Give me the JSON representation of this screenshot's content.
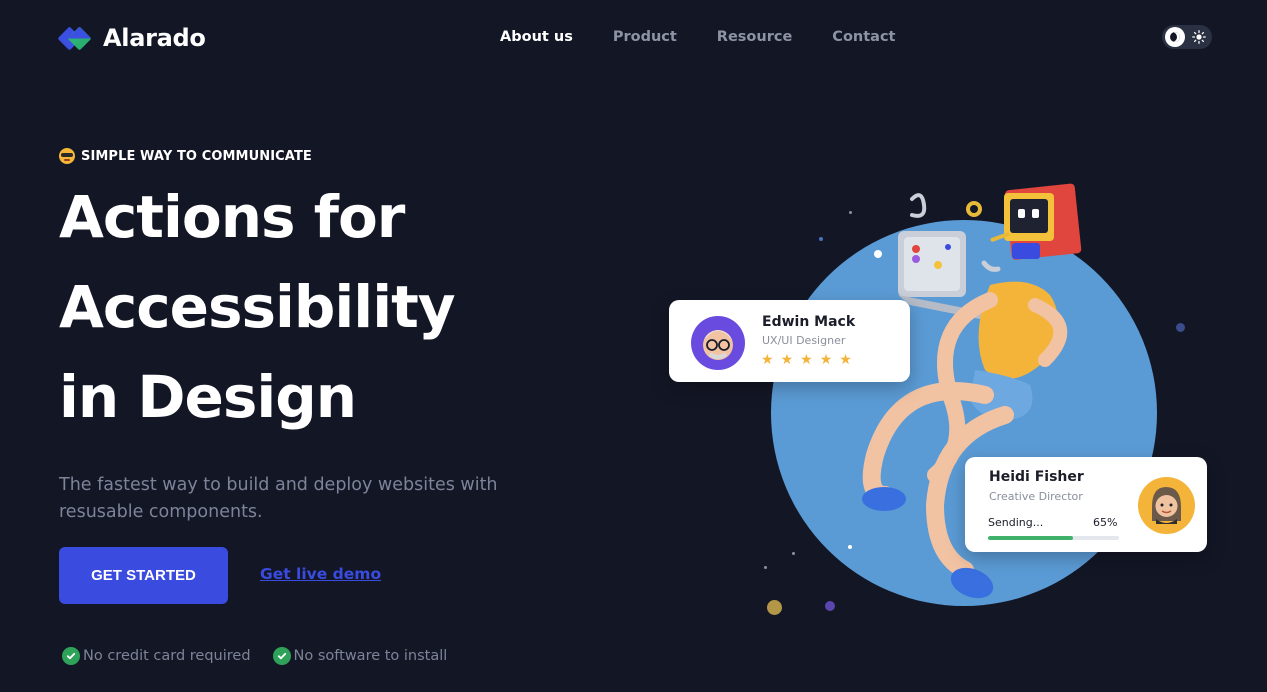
{
  "brand": {
    "name": "Alarado",
    "primary": "#3a4be0",
    "accent": "#2bb673",
    "bg": "#131625"
  },
  "nav": {
    "items": [
      {
        "label": "About us",
        "active": true
      },
      {
        "label": "Product",
        "active": false
      },
      {
        "label": "Resource",
        "active": false
      },
      {
        "label": "Contact",
        "active": false
      }
    ]
  },
  "theme_toggle": {
    "icons": [
      "moon-icon",
      "sun-icon"
    ],
    "selected": "dark"
  },
  "hero": {
    "eyebrow": "SIMPLE WAY TO COMMUNICATE",
    "headline_lines": [
      "Actions for",
      "Accessibility",
      "in Design"
    ],
    "lead_line1": "The fastest way to build and deploy websites with",
    "lead_line2": "resusable components.",
    "cta_primary": "GET STARTED",
    "cta_secondary": "Get live demo",
    "checks": [
      "No credit card required",
      "No software to install"
    ]
  },
  "cards": {
    "edwin": {
      "name": "Edwin Mack",
      "role": "UX/UI Designer",
      "rating": 5
    },
    "heidi": {
      "name": "Heidi Fisher",
      "role": "Creative Director",
      "status": "Sending...",
      "progress_label": "65%",
      "progress": 0.65
    }
  }
}
